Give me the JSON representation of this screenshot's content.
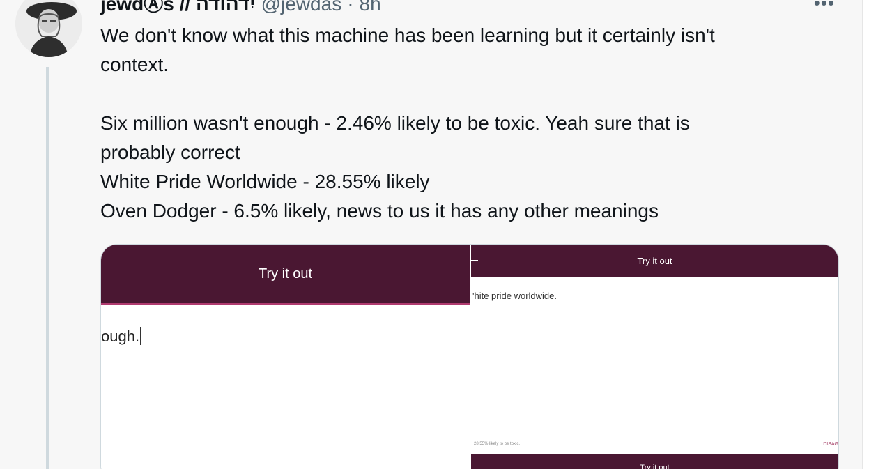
{
  "tweet": {
    "display_name": "jewdⒶs // יִדהודה",
    "handle": "@jewdas",
    "separator": "·",
    "time": "8h",
    "more_label": "•••",
    "text_lines": [
      "We don't know what this machine has been learning but it certainly isn't",
      "context.",
      "",
      "Six million wasn't enough - 2.46% likely to be toxic. Yeah sure that is",
      "probably correct",
      "White Pride Worldwide - 28.55% likely",
      "Oven Dodger - 6.5% likely, news to us it has any other meanings"
    ]
  },
  "media": {
    "left": {
      "try_label": "Try it out",
      "input_text": "ough."
    },
    "right": {
      "try_label": "Try it out",
      "input_text": "'hite pride worldwide.",
      "result_text": "28.55% likely to be toxic.",
      "disagree_label": "DISAG",
      "try_label_2": "Try it out"
    }
  },
  "colors": {
    "bar": "#4a1732",
    "accent": "#b03a6f",
    "thread_line": "#cfd9de",
    "muted_text": "#536471"
  },
  "icons": {
    "avatar": "portrait-avatar-icon"
  }
}
